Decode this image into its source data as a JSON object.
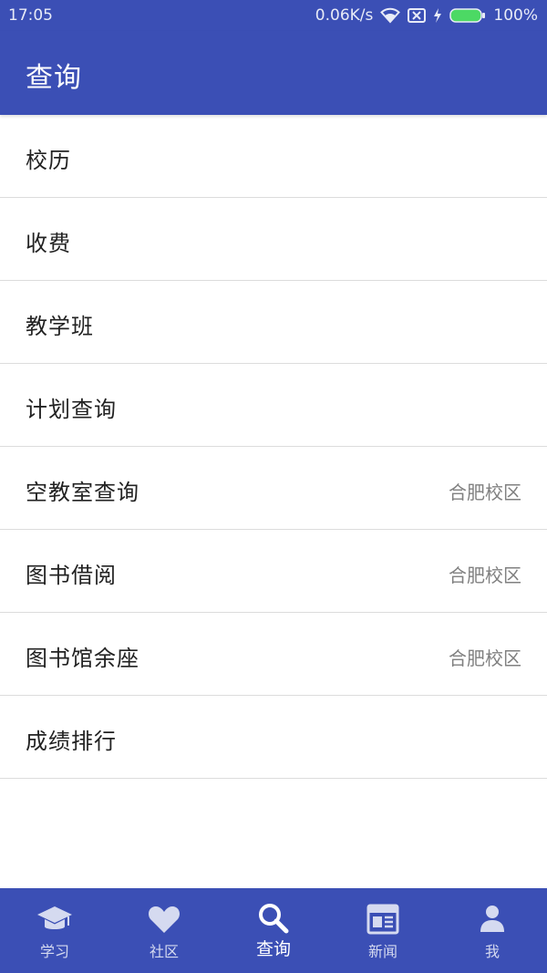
{
  "status_bar": {
    "time": "17:05",
    "network_speed": "0.06K/s",
    "battery": "100%",
    "icons": [
      "wifi-icon",
      "no-sim-icon",
      "charging-icon",
      "battery-icon"
    ]
  },
  "header": {
    "title": "查询"
  },
  "menu": {
    "items": [
      {
        "label": "校历",
        "tag": ""
      },
      {
        "label": "收费",
        "tag": ""
      },
      {
        "label": "教学班",
        "tag": ""
      },
      {
        "label": "计划查询",
        "tag": ""
      },
      {
        "label": "空教室查询",
        "tag": "合肥校区"
      },
      {
        "label": "图书借阅",
        "tag": "合肥校区"
      },
      {
        "label": "图书馆余座",
        "tag": "合肥校区"
      },
      {
        "label": "成绩排行",
        "tag": ""
      }
    ]
  },
  "bottom_nav": {
    "items": [
      {
        "label": "学习",
        "icon": "graduation-cap-icon",
        "active": false
      },
      {
        "label": "社区",
        "icon": "heart-icon",
        "active": false
      },
      {
        "label": "查询",
        "icon": "search-icon",
        "active": true
      },
      {
        "label": "新闻",
        "icon": "newspaper-icon",
        "active": false
      },
      {
        "label": "我",
        "icon": "person-icon",
        "active": false
      }
    ]
  },
  "colors": {
    "primary": "#3b4fb5",
    "divider": "#dcdcdc",
    "text": "#222222",
    "secondary_text": "#808080",
    "battery": "#4cd964"
  }
}
